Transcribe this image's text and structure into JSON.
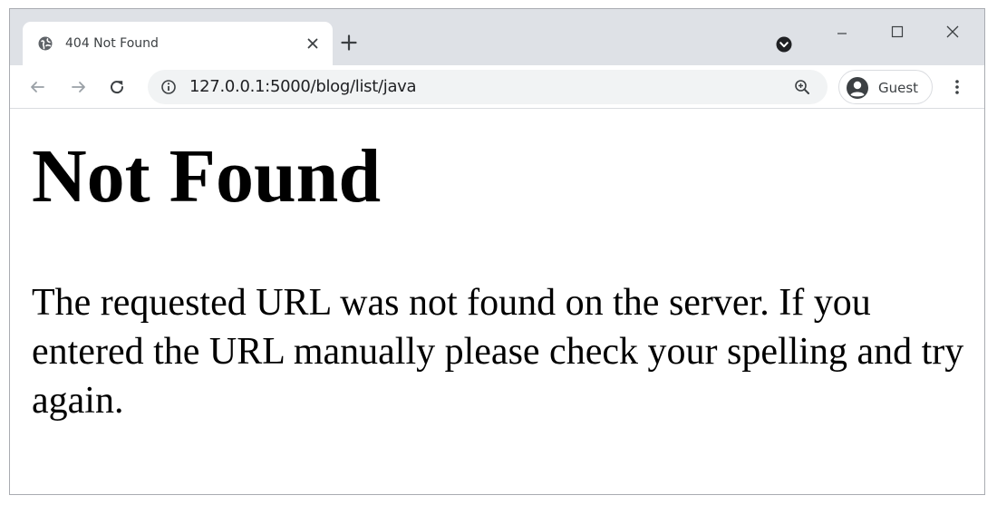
{
  "browser": {
    "tab": {
      "title": "404 Not Found",
      "favicon": "globe-icon",
      "close_icon": "close-icon"
    },
    "new_tab_icon": "plus-icon",
    "tab_search_icon": "tab-search-icon",
    "window_controls": [
      "minimize-icon",
      "maximize-icon",
      "close-icon"
    ],
    "toolbar": {
      "back_icon": "arrow-left-icon",
      "forward_icon": "arrow-right-icon",
      "reload_icon": "reload-icon",
      "site_info_icon": "info-icon",
      "url": "127.0.0.1:5000/blog/list/java",
      "zoom_icon": "zoom-icon",
      "profile_label": "Guest",
      "profile_icon": "avatar-icon",
      "menu_icon": "kebab-menu-icon"
    },
    "colors": {
      "titlebar": "#dee1e6",
      "omnibox": "#f1f3f4",
      "page_background": "#ffffff",
      "text": "#000000"
    }
  },
  "page": {
    "heading": "Not Found",
    "message": "The requested URL was not found on the server. If you entered the URL manually please check your spelling and try again."
  }
}
